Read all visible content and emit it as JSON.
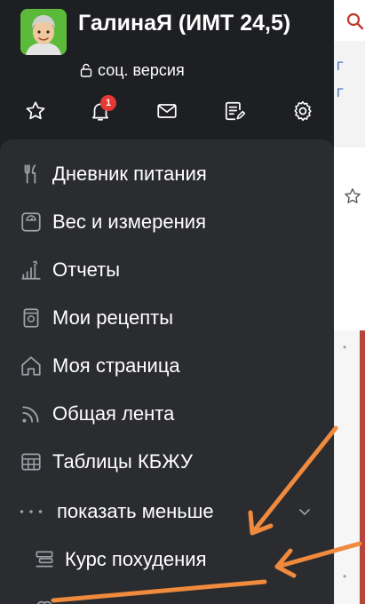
{
  "header": {
    "user_name": "ГалинаЯ (ИМТ 24,5)",
    "version_label": "соц. версия",
    "notification_count": "1"
  },
  "menu": {
    "items": [
      {
        "label": "Дневник питания",
        "icon": "fork-knife-icon"
      },
      {
        "label": "Вес и измерения",
        "icon": "scale-icon"
      },
      {
        "label": "Отчеты",
        "icon": "chart-bars-icon"
      },
      {
        "label": "Мои рецепты",
        "icon": "recipe-jar-icon"
      },
      {
        "label": "Моя страница",
        "icon": "home-icon"
      },
      {
        "label": "Общая лента",
        "icon": "rss-feed-icon"
      },
      {
        "label": "Таблицы КБЖУ",
        "icon": "table-icon"
      }
    ],
    "show_less_label": "показать меньше",
    "sub_items": [
      {
        "label": "Курс похудения",
        "icon": "course-stack-icon"
      }
    ]
  },
  "background": {
    "letters": [
      "Г",
      "Г"
    ]
  },
  "colors": {
    "drawer_bg": "#1e1f22",
    "menu_bg": "#2b2c30",
    "badge": "#e53935",
    "annotation_arrow": "#f08a3c"
  }
}
